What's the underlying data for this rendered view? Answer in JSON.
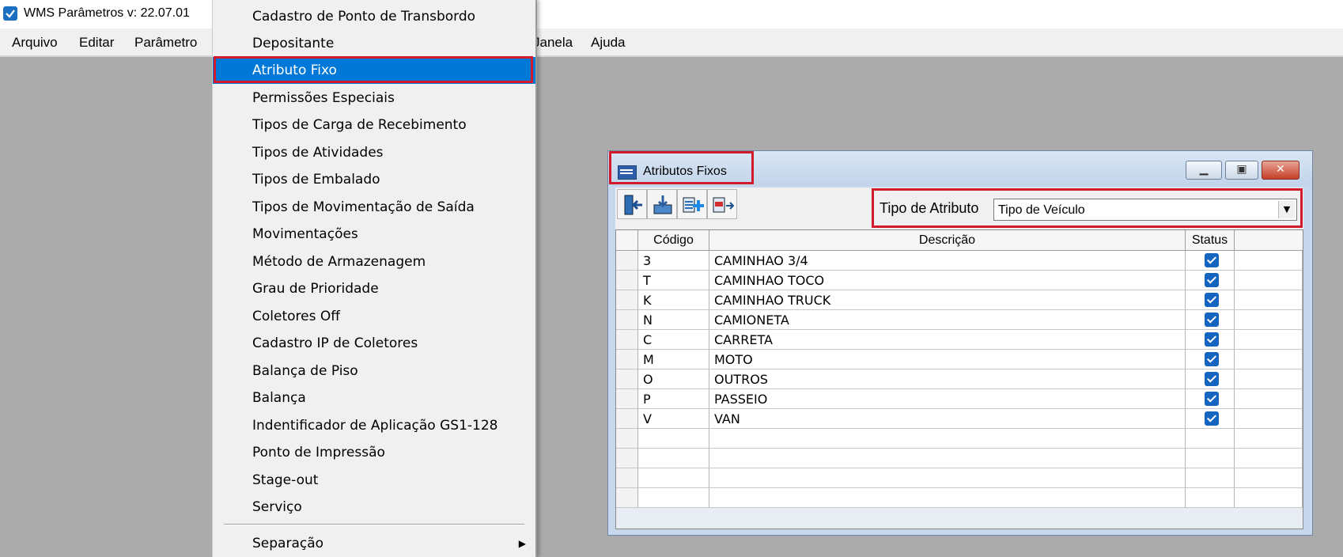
{
  "app": {
    "title": "WMS Parâmetros  v: 22.07.01"
  },
  "menubar": [
    "Arquivo",
    "Editar",
    "Parâmetro",
    "Janela",
    "Ajuda"
  ],
  "dropdown": {
    "items": [
      "Cadastro de Ponto de Transbordo",
      "Depositante",
      "Atributo Fixo",
      "Permissões Especiais",
      "Tipos de Carga de Recebimento",
      "Tipos de Atividades",
      "Tipos de Embalado",
      "Tipos de Movimentação de Saída",
      "Movimentações",
      "Método de Armazenagem",
      "Grau de Prioridade",
      "Coletores Off",
      "Cadastro IP de Coletores",
      "Balança de Piso",
      "Balança",
      "Indentificador de Aplicação GS1-128",
      "Ponto de Impressão",
      "Stage-out",
      "Serviço"
    ],
    "selected": "Atributo Fixo",
    "submenu_item": "Separação",
    "highlight_color": "#0078d7"
  },
  "window": {
    "title": "Atributos Fixos",
    "tipo_label": "Tipo de Atributo",
    "tipo_value": "Tipo de Veículo",
    "toolbar_icons": [
      "exit-icon",
      "save-icon",
      "add-icon",
      "remove-icon"
    ]
  },
  "grid": {
    "headers": [
      "Código",
      "Descrição",
      "Status"
    ],
    "rows": [
      {
        "codigo": "3",
        "descricao": "CAMINHAO 3/4",
        "status": true
      },
      {
        "codigo": "T",
        "descricao": "CAMINHAO TOCO",
        "status": true
      },
      {
        "codigo": "K",
        "descricao": "CAMINHAO TRUCK",
        "status": true
      },
      {
        "codigo": "N",
        "descricao": "CAMIONETA",
        "status": true
      },
      {
        "codigo": "C",
        "descricao": "CARRETA",
        "status": true
      },
      {
        "codigo": "M",
        "descricao": "MOTO",
        "status": true
      },
      {
        "codigo": "O",
        "descricao": "OUTROS",
        "status": true
      },
      {
        "codigo": "P",
        "descricao": "PASSEIO",
        "status": true
      },
      {
        "codigo": "V",
        "descricao": "VAN",
        "status": true
      }
    ],
    "empty_rows": 4
  },
  "annotation_color": "#d11a2a"
}
